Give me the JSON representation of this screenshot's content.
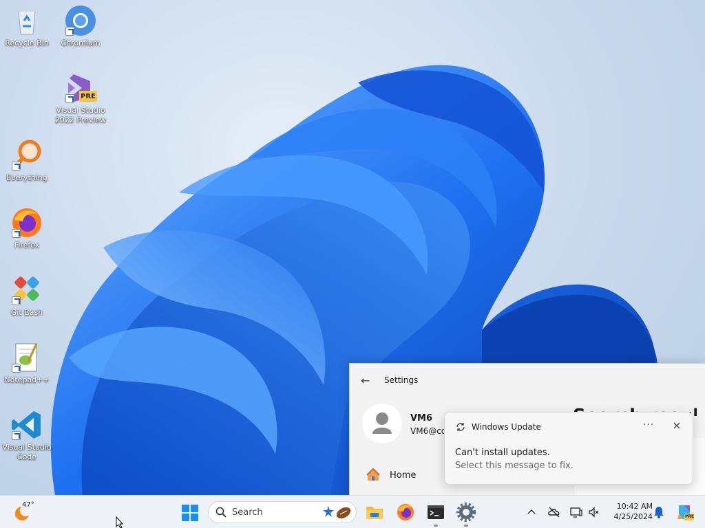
{
  "desktop": {
    "icons": [
      {
        "label": "Recycle Bin",
        "icon": "recycle-bin-icon"
      },
      {
        "label": "Chromium",
        "icon": "chromium-icon"
      },
      {
        "label": "Visual Studio 2022 Preview",
        "line1": "Visual Studio",
        "line2": "2022 Preview",
        "badge": "PRE",
        "icon": "visual-studio-icon"
      },
      {
        "label": "Everything",
        "icon": "everything-search-icon"
      },
      {
        "label": "Firefox",
        "icon": "firefox-icon"
      },
      {
        "label": "Git Bash",
        "icon": "git-bash-icon"
      },
      {
        "label": "Notepad++",
        "icon": "notepad-plus-plus-icon"
      },
      {
        "label": "Visual Studio Code",
        "line1": "Visual Studio",
        "line2": "Code",
        "icon": "vscode-icon"
      }
    ]
  },
  "settings": {
    "title": "Settings",
    "user_name": "VM6",
    "user_email": "VM6@co",
    "nav_home": "Home",
    "heading_peek": "Search results"
  },
  "toast": {
    "app_name": "Windows Update",
    "more": "···",
    "title": "Can't install updates.",
    "body": "Select this message to fix."
  },
  "taskbar": {
    "weather_temp": "47°",
    "search_placeholder": "Search",
    "time": "10:42 AM",
    "date": "4/25/2024"
  },
  "colors": {
    "accent": "#0067c0",
    "bloom_blue": "#1a6fe8",
    "taskbar_bg": "#eef2f7"
  }
}
